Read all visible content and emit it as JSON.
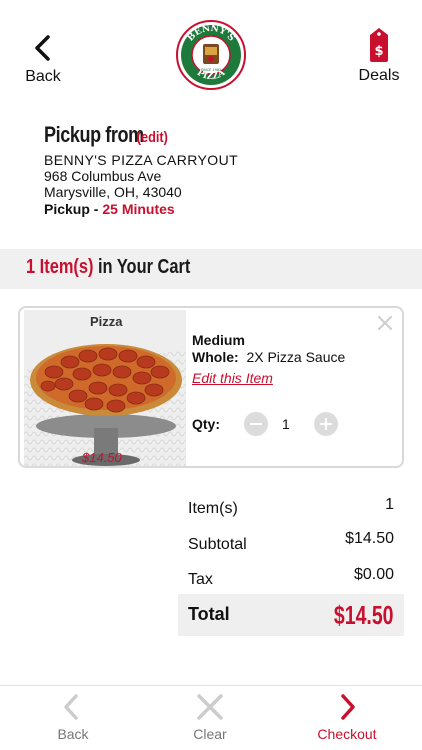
{
  "header": {
    "back_label": "Back",
    "deals_label": "Deals",
    "logo_text_top": "BENNY'S",
    "logo_text_bottom": "PIZZA",
    "logo_since": "SINCE 1982"
  },
  "pickup": {
    "title": "Pickup from",
    "edit_label": "(edit)",
    "store_name": "BENNY'S PIZZA CARRYOUT",
    "address_line1": "968 Columbus Ave",
    "address_line2": "Marysville, OH, 43040",
    "time_label": "Pickup - ",
    "time_value": "25 Minutes"
  },
  "cart": {
    "count_text": "1 Item(s)",
    "title_rest": " in Your Cart"
  },
  "item": {
    "image_caption": "Pizza",
    "image_price": "$14.50",
    "size": "Medium",
    "whole_label": "Whole:",
    "whole_value": "2X Pizza Sauce",
    "edit_label": "Edit this Item",
    "qty_label": "Qty:",
    "qty_value": "1"
  },
  "summary": {
    "items_label": "Item(s)",
    "items_value": "1",
    "subtotal_label": "Subtotal",
    "subtotal_value": "$14.50",
    "tax_label": "Tax",
    "tax_value": "$0.00",
    "total_label": "Total",
    "total_value": "$14.50"
  },
  "toolbar": {
    "back_label": "Back",
    "clear_label": "Clear",
    "checkout_label": "Checkout"
  },
  "colors": {
    "accent": "#c8102e",
    "logo_green": "#1e7a3a",
    "muted": "#777777"
  }
}
